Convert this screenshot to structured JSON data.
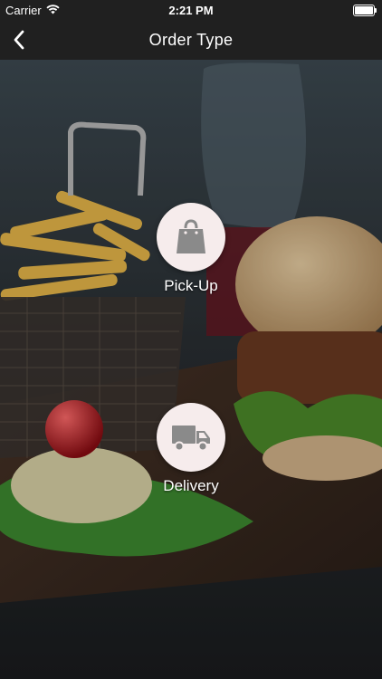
{
  "status": {
    "carrier": "Carrier",
    "time": "2:21 PM"
  },
  "nav": {
    "title": "Order Type",
    "back_icon": "chevron-left-icon"
  },
  "options": [
    {
      "label": "Pick-Up",
      "icon": "shopping-bag-icon"
    },
    {
      "label": "Delivery",
      "icon": "truck-icon"
    }
  ],
  "colors": {
    "bar": "#202020",
    "circle": "#f6ecec",
    "icon": "#8a8a8a"
  }
}
